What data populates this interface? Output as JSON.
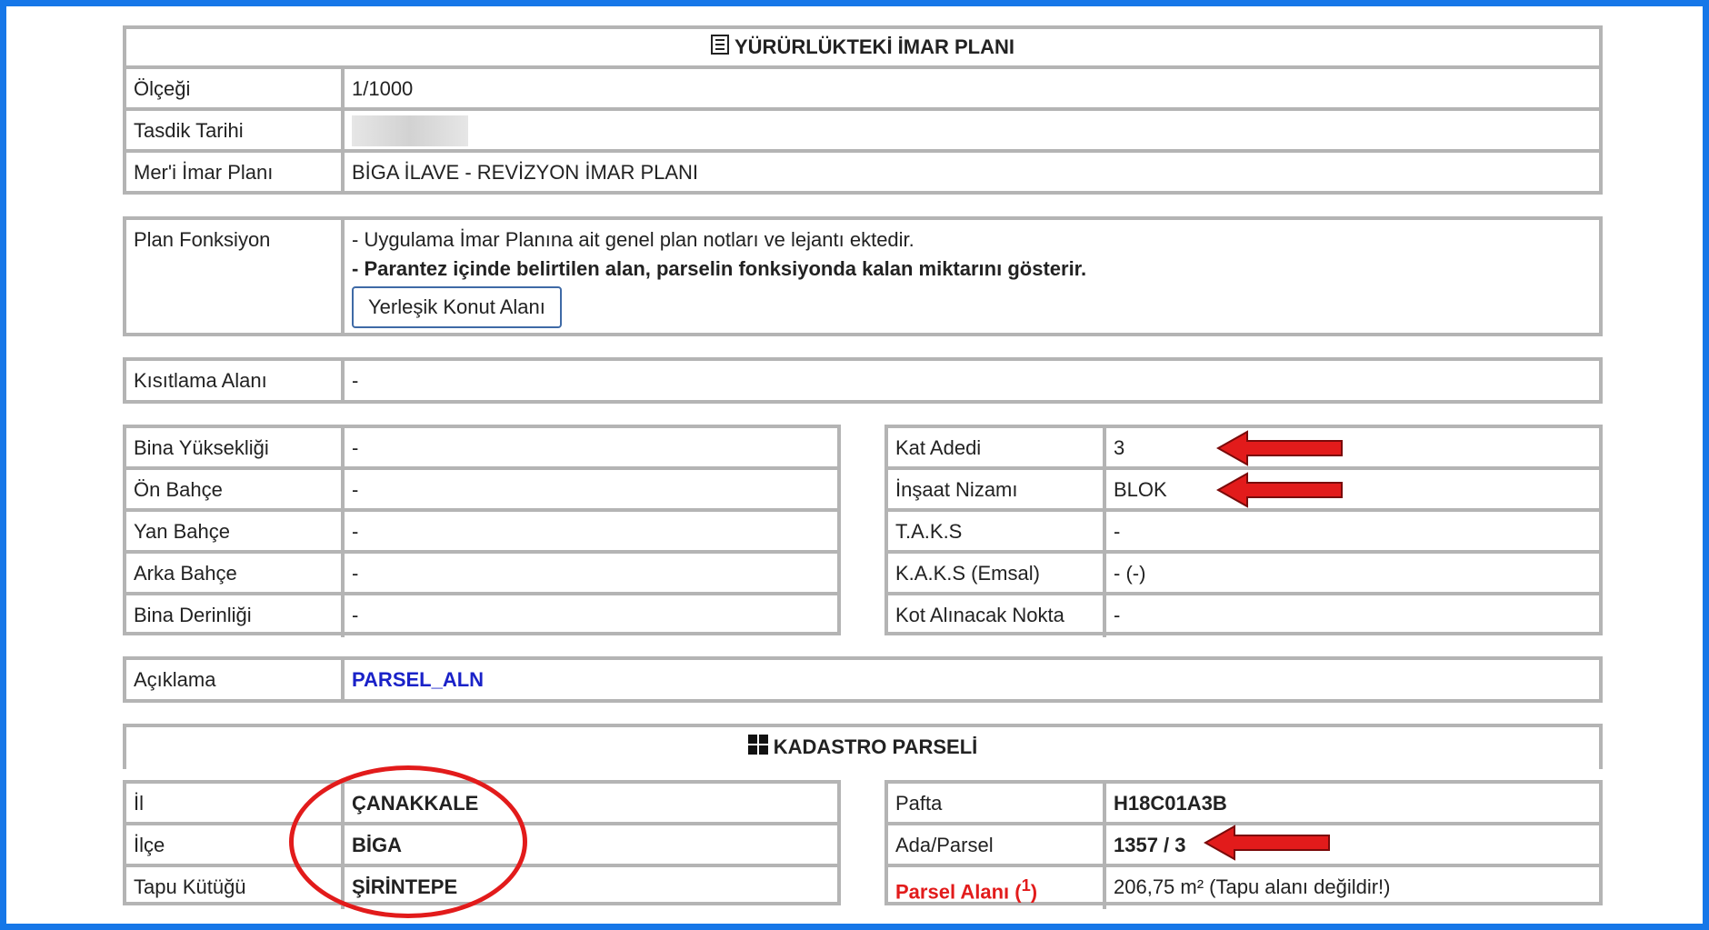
{
  "imar": {
    "title": "YÜRÜRLÜKTEKİ İMAR PLANI",
    "rows": [
      {
        "label": "Ölçeği",
        "value": "1/1000"
      },
      {
        "label": "Tasdik Tarihi",
        "value": ""
      },
      {
        "label": "Mer'i İmar Planı",
        "value": "BİGA İLAVE - REVİZYON İMAR PLANI"
      }
    ]
  },
  "plan": {
    "label": "Plan Fonksiyon",
    "note1": "- Uygulama İmar Planına ait genel plan notları ve lejantı ektedir.",
    "note2": "- Parantez içinde belirtilen alan, parselin fonksiyonda kalan miktarını gösterir.",
    "button": "Yerleşik Konut Alanı"
  },
  "kisit": {
    "label": "Kısıtlama Alanı",
    "value": "-"
  },
  "left": [
    {
      "label": "Bina Yüksekliği",
      "value": "-"
    },
    {
      "label": "Ön Bahçe",
      "value": "-"
    },
    {
      "label": "Yan Bahçe",
      "value": "-"
    },
    {
      "label": "Arka Bahçe",
      "value": "-"
    },
    {
      "label": "Bina Derinliği",
      "value": "-"
    }
  ],
  "right": [
    {
      "label": "Kat Adedi",
      "value": "3"
    },
    {
      "label": "İnşaat Nizamı",
      "value": "BLOK"
    },
    {
      "label": "T.A.K.S",
      "value": "-"
    },
    {
      "label": "K.A.K.S (Emsal)",
      "value": "- (-)"
    },
    {
      "label": "Kot Alınacak Nokta",
      "value": "-"
    }
  ],
  "aciklama": {
    "label": "Açıklama",
    "value": "PARSEL_ALN"
  },
  "kadastro": {
    "title": "KADASTRO PARSELİ",
    "left": [
      {
        "label": "İl",
        "value": "ÇANAKKALE"
      },
      {
        "label": "İlçe",
        "value": "BİGA"
      },
      {
        "label": "Tapu Kütüğü",
        "value": "ŞİRİNTEPE"
      }
    ],
    "right": [
      {
        "label": "Pafta",
        "value": "H18C01A3B"
      },
      {
        "label": "Ada/Parsel",
        "value": "1357 / 3"
      },
      {
        "label": "Parsel Alanı",
        "sup": "1",
        "value": "206,75 m² (Tapu alanı değildir!)"
      }
    ]
  },
  "colors": {
    "accent_border": "#1677e8",
    "annotation_red": "#e21b1b",
    "link_blue": "#1a22c8"
  }
}
